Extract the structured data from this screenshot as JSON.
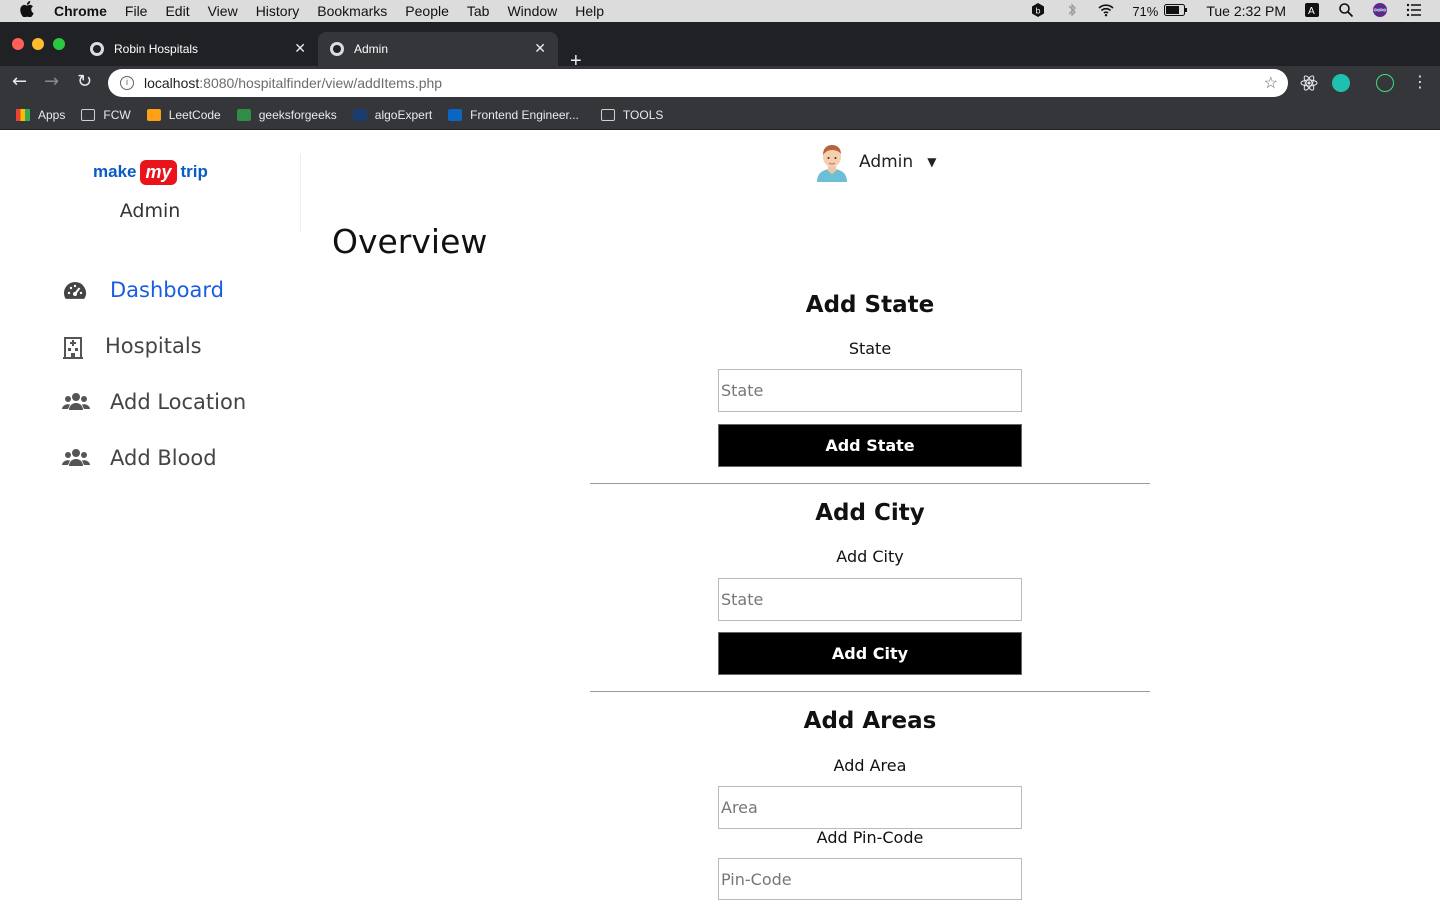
{
  "menubar": {
    "app": "Chrome",
    "items": [
      "File",
      "Edit",
      "View",
      "History",
      "Bookmarks",
      "People",
      "Tab",
      "Window",
      "Help"
    ],
    "battery": "71%",
    "clock": "Tue 2:32 PM"
  },
  "tabs": [
    {
      "title": "Robin Hospitals"
    },
    {
      "title": "Admin"
    }
  ],
  "omnibox": {
    "host": "localhost",
    "path": ":8080/hospitalfinder/view/addItems.php"
  },
  "bookmarks": [
    "Apps",
    "FCW",
    "LeetCode",
    "geeksforgeeks",
    "algoExpert",
    "Frontend Engineer...",
    "TOOLS"
  ],
  "sidebar": {
    "logo": {
      "make": "make",
      "my": "my",
      "trip": "trip"
    },
    "role": "Admin",
    "items": [
      {
        "label": "Dashboard",
        "icon": "tachometer-icon"
      },
      {
        "label": "Hospitals",
        "icon": "hospital-icon"
      },
      {
        "label": "Add Location",
        "icon": "users-icon"
      },
      {
        "label": "Add Blood",
        "icon": "users-icon"
      }
    ]
  },
  "header": {
    "user": "Admin"
  },
  "main": {
    "title": "Overview",
    "state": {
      "title": "Add State",
      "label": "State",
      "placeholder": "State",
      "button": "Add State"
    },
    "city": {
      "title": "Add City",
      "label": "Add City",
      "placeholder": "State",
      "button": "Add City"
    },
    "areas": {
      "title": "Add Areas",
      "area_label": "Add Area",
      "area_placeholder": "Area",
      "pin_label": "Add Pin-Code",
      "pin_placeholder": "Pin-Code"
    }
  }
}
